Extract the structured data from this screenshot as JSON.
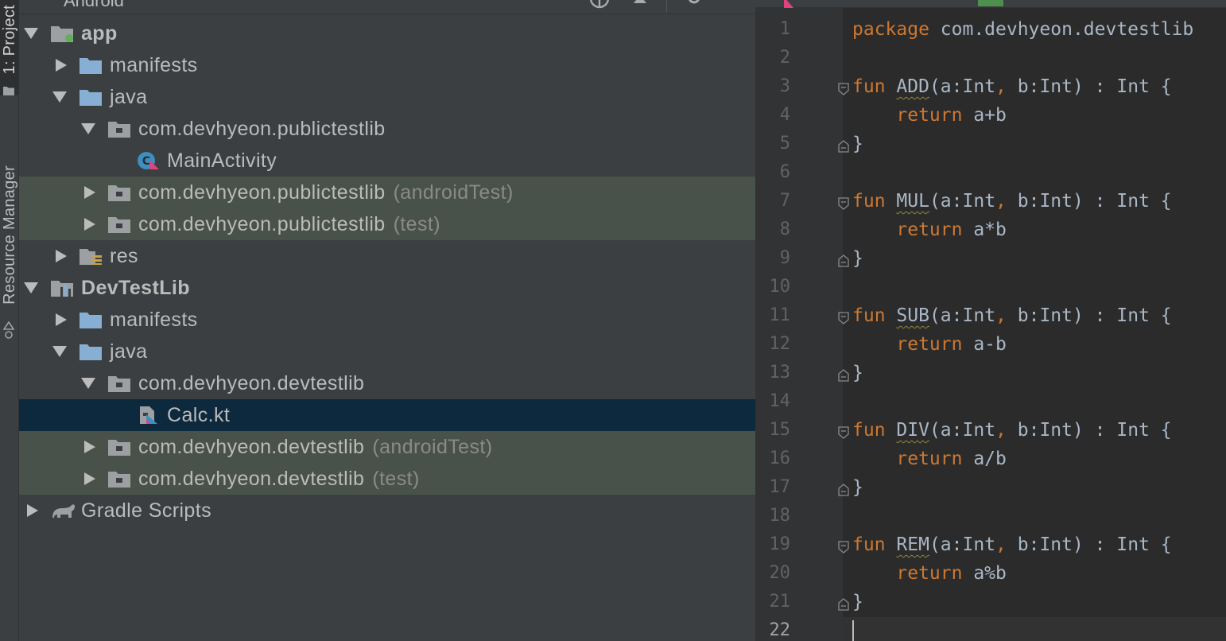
{
  "toolstrip": {
    "project_tab": "1: Project",
    "resource_tab": "Resource Manager"
  },
  "panel": {
    "title": "Android"
  },
  "tree": [
    {
      "label": "app",
      "suffix": "",
      "indent": 0,
      "state": "expanded",
      "icon": "module-app-icon",
      "bold": true,
      "style": ""
    },
    {
      "label": "manifests",
      "suffix": "",
      "indent": 1,
      "state": "collapsed",
      "icon": "folder-icon",
      "bold": false,
      "style": ""
    },
    {
      "label": "java",
      "suffix": "",
      "indent": 1,
      "state": "expanded",
      "icon": "folder-icon",
      "bold": false,
      "style": ""
    },
    {
      "label": "com.devhyeon.publictestlib",
      "suffix": "",
      "indent": 2,
      "state": "expanded",
      "icon": "package-icon",
      "bold": false,
      "style": ""
    },
    {
      "label": "MainActivity",
      "suffix": "",
      "indent": 3,
      "state": "none",
      "icon": "kotlin-class-icon",
      "bold": false,
      "style": ""
    },
    {
      "label": "com.devhyeon.publictestlib",
      "suffix": "(androidTest)",
      "indent": 2,
      "state": "collapsed",
      "icon": "package-icon",
      "bold": false,
      "style": "test"
    },
    {
      "label": "com.devhyeon.publictestlib",
      "suffix": "(test)",
      "indent": 2,
      "state": "collapsed",
      "icon": "package-icon",
      "bold": false,
      "style": "test"
    },
    {
      "label": "res",
      "suffix": "",
      "indent": 1,
      "state": "collapsed",
      "icon": "res-folder-icon",
      "bold": false,
      "style": ""
    },
    {
      "label": "DevTestLib",
      "suffix": "",
      "indent": 0,
      "state": "expanded",
      "icon": "module-lib-icon",
      "bold": true,
      "style": ""
    },
    {
      "label": "manifests",
      "suffix": "",
      "indent": 1,
      "state": "collapsed",
      "icon": "folder-icon",
      "bold": false,
      "style": ""
    },
    {
      "label": "java",
      "suffix": "",
      "indent": 1,
      "state": "expanded",
      "icon": "folder-icon",
      "bold": false,
      "style": ""
    },
    {
      "label": "com.devhyeon.devtestlib",
      "suffix": "",
      "indent": 2,
      "state": "expanded",
      "icon": "package-icon",
      "bold": false,
      "style": ""
    },
    {
      "label": "Calc.kt",
      "suffix": "",
      "indent": 3,
      "state": "none",
      "icon": "kotlin-file-icon",
      "bold": false,
      "style": "selected"
    },
    {
      "label": "com.devhyeon.devtestlib",
      "suffix": "(androidTest)",
      "indent": 2,
      "state": "collapsed",
      "icon": "package-icon",
      "bold": false,
      "style": "test"
    },
    {
      "label": "com.devhyeon.devtestlib",
      "suffix": "(test)",
      "indent": 2,
      "state": "collapsed",
      "icon": "package-icon",
      "bold": false,
      "style": "test"
    },
    {
      "label": "Gradle Scripts",
      "suffix": "",
      "indent": 0,
      "state": "collapsed",
      "icon": "gradle-icon",
      "bold": false,
      "style": ""
    }
  ],
  "editor": {
    "line_numbers": [
      "1",
      "2",
      "3",
      "4",
      "5",
      "6",
      "7",
      "8",
      "9",
      "10",
      "11",
      "12",
      "13",
      "14",
      "15",
      "16",
      "17",
      "18",
      "19",
      "20",
      "21",
      "22"
    ],
    "current_line": "22",
    "code": [
      {
        "line": "1",
        "parts": [
          {
            "t": "package",
            "c": "kw"
          },
          {
            "t": " com.devhyeon.devtestlib",
            "c": ""
          }
        ],
        "fold": ""
      },
      {
        "line": "2",
        "parts": [],
        "fold": ""
      },
      {
        "line": "3",
        "parts": [
          {
            "t": "fun",
            "c": "kw"
          },
          {
            "t": " ",
            "c": ""
          },
          {
            "t": "ADD",
            "c": "fn"
          },
          {
            "t": "(a:Int",
            "c": ""
          },
          {
            "t": ",",
            "c": "kw"
          },
          {
            "t": " b:Int) : Int {",
            "c": ""
          }
        ],
        "fold": "open"
      },
      {
        "line": "4",
        "parts": [
          {
            "t": "    return",
            "c": "kw"
          },
          {
            "t": " a+b",
            "c": ""
          }
        ],
        "fold": ""
      },
      {
        "line": "5",
        "parts": [
          {
            "t": "}",
            "c": ""
          }
        ],
        "fold": "close"
      },
      {
        "line": "6",
        "parts": [],
        "fold": ""
      },
      {
        "line": "7",
        "parts": [
          {
            "t": "fun",
            "c": "kw"
          },
          {
            "t": " ",
            "c": ""
          },
          {
            "t": "MUL",
            "c": "fn"
          },
          {
            "t": "(a:Int",
            "c": ""
          },
          {
            "t": ",",
            "c": "kw"
          },
          {
            "t": " b:Int) : Int {",
            "c": ""
          }
        ],
        "fold": "open"
      },
      {
        "line": "8",
        "parts": [
          {
            "t": "    return",
            "c": "kw"
          },
          {
            "t": " a*b",
            "c": ""
          }
        ],
        "fold": ""
      },
      {
        "line": "9",
        "parts": [
          {
            "t": "}",
            "c": ""
          }
        ],
        "fold": "close"
      },
      {
        "line": "10",
        "parts": [],
        "fold": ""
      },
      {
        "line": "11",
        "parts": [
          {
            "t": "fun",
            "c": "kw"
          },
          {
            "t": " ",
            "c": ""
          },
          {
            "t": "SUB",
            "c": "fn"
          },
          {
            "t": "(a:Int",
            "c": ""
          },
          {
            "t": ",",
            "c": "kw"
          },
          {
            "t": " b:Int) : Int {",
            "c": ""
          }
        ],
        "fold": "open"
      },
      {
        "line": "12",
        "parts": [
          {
            "t": "    return",
            "c": "kw"
          },
          {
            "t": " a-b",
            "c": ""
          }
        ],
        "fold": ""
      },
      {
        "line": "13",
        "parts": [
          {
            "t": "}",
            "c": ""
          }
        ],
        "fold": "close"
      },
      {
        "line": "14",
        "parts": [],
        "fold": ""
      },
      {
        "line": "15",
        "parts": [
          {
            "t": "fun",
            "c": "kw"
          },
          {
            "t": " ",
            "c": ""
          },
          {
            "t": "DIV",
            "c": "fn"
          },
          {
            "t": "(a:Int",
            "c": ""
          },
          {
            "t": ",",
            "c": "kw"
          },
          {
            "t": " b:Int) : Int {",
            "c": ""
          }
        ],
        "fold": "open"
      },
      {
        "line": "16",
        "parts": [
          {
            "t": "    return",
            "c": "kw"
          },
          {
            "t": " a/b",
            "c": ""
          }
        ],
        "fold": ""
      },
      {
        "line": "17",
        "parts": [
          {
            "t": "}",
            "c": ""
          }
        ],
        "fold": "close"
      },
      {
        "line": "18",
        "parts": [],
        "fold": ""
      },
      {
        "line": "19",
        "parts": [
          {
            "t": "fun",
            "c": "kw"
          },
          {
            "t": " ",
            "c": ""
          },
          {
            "t": "REM",
            "c": "fn"
          },
          {
            "t": "(a:Int",
            "c": ""
          },
          {
            "t": ",",
            "c": "kw"
          },
          {
            "t": " b:Int) : Int {",
            "c": ""
          }
        ],
        "fold": "open"
      },
      {
        "line": "20",
        "parts": [
          {
            "t": "    return",
            "c": "kw"
          },
          {
            "t": " a%b",
            "c": ""
          }
        ],
        "fold": ""
      },
      {
        "line": "21",
        "parts": [
          {
            "t": "}",
            "c": ""
          }
        ],
        "fold": "close"
      },
      {
        "line": "22",
        "parts": [],
        "fold": ""
      }
    ]
  },
  "colors": {
    "keyword": "#cc7832",
    "text": "#a9b7c6",
    "folder": "#87aed3",
    "test_row_bg": "#49524a",
    "selected_row_bg": "#0d293e"
  }
}
